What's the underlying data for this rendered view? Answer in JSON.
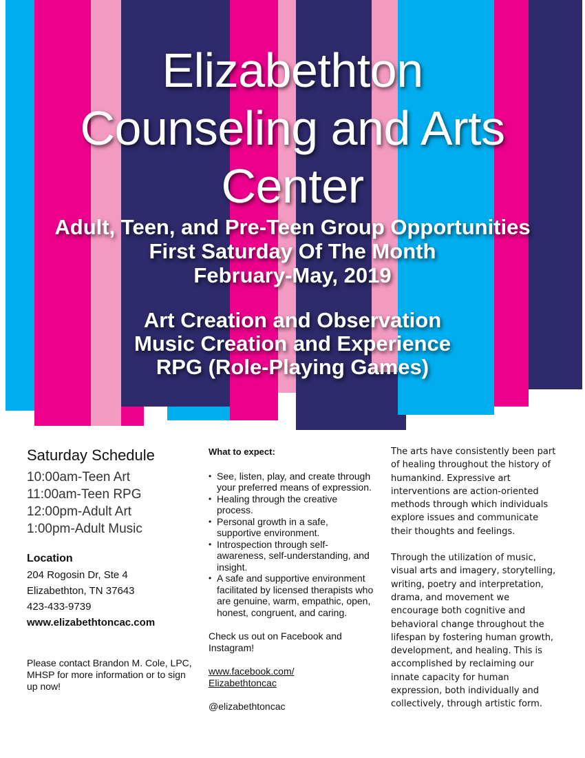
{
  "colors": {
    "cyan": "#00aeef",
    "magenta": "#ec008c",
    "pink": "#f49ac1",
    "navy": "#2e2a6b"
  },
  "title_lines": [
    "Elizabethton",
    "Counseling and Arts",
    "Center"
  ],
  "subtitle_lines": [
    "Adult, Teen, and Pre-Teen Group Opportunities",
    "First Saturday Of The Month",
    "February-May, 2019"
  ],
  "offering_lines": [
    "Art Creation and Observation",
    "Music Creation and Experience",
    "RPG (Role-Playing Games)"
  ],
  "schedule": {
    "title": "Saturday Schedule",
    "items": [
      "10:00am-Teen Art",
      "11:00am-Teen RPG",
      "12:00pm-Adult Art",
      "1:00pm-Adult Music"
    ]
  },
  "location": {
    "title": "Location",
    "address_line1": "204 Rogosin Dr, Ste 4",
    "address_line2": "Elizabethton, TN 37643",
    "phone": "423-433-9739",
    "website": "www.elizabethtoncac.com"
  },
  "contact_text": "Please contact Brandon M. Cole, LPC, MHSP for more information or to sign up now!",
  "expect": {
    "title": "What to expect:",
    "bullets": [
      "See, listen, play, and create through your preferred means of expression.",
      "Healing through the creative process.",
      "Personal growth in a safe, supportive environment.",
      "Introspection through self-awareness, self-understanding, and insight.",
      "A safe and supportive environment facilitated by licensed therapists who are genuine, warm, empathic, open, honest, congruent, and caring."
    ]
  },
  "social": {
    "text": "Check us out on Facebook and Instagram!",
    "facebook_line1": "www.facebook.com/",
    "facebook_line2": "Elizabethtoncac",
    "instagram": "@elizabethtoncac"
  },
  "about": {
    "paragraph1": "The arts have consistently been part of healing throughout the history of humankind. Expressive art interventions are action-oriented methods through which individuals explore issues and communicate their thoughts and feelings.",
    "paragraph2": "Through the utilization of music, visual arts and imagery, storytelling, writing, poetry and interpretation, drama, and movement we encourage both cognitive and behavioral change throughout the lifespan by fostering human growth, development, and healing. This is accomplished by reclaiming our innate capacity for human expression, both individually and collectively, through artistic form."
  }
}
